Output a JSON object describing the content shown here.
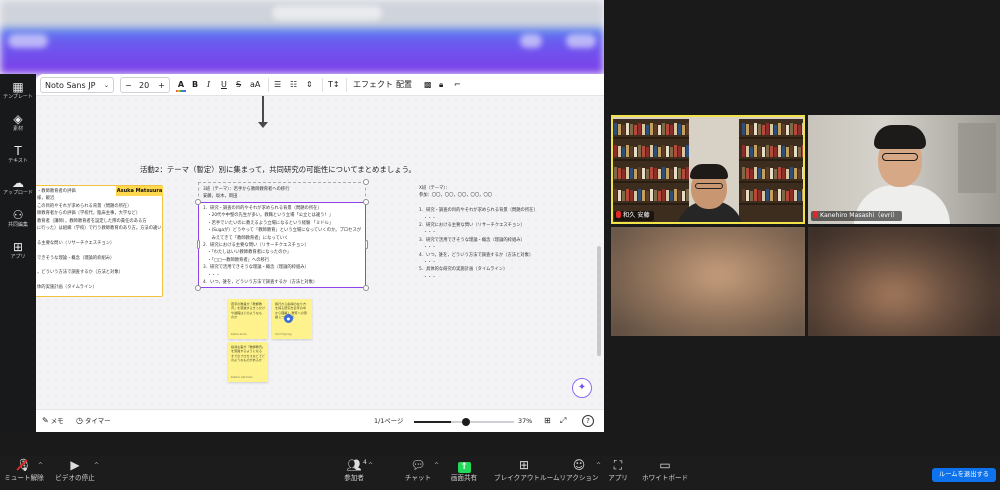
{
  "canva": {
    "font_name": "Noto Sans JP",
    "font_size": "20",
    "effect_label": "エフェクト",
    "arrange_label": "配置",
    "sidebar": [
      {
        "label": "テンプレート",
        "icon": "template-icon",
        "glyph": "▦"
      },
      {
        "label": "素材",
        "icon": "elements-icon",
        "glyph": "◈"
      },
      {
        "label": "テキスト",
        "icon": "text-icon",
        "glyph": "T"
      },
      {
        "label": "アップロード",
        "icon": "upload-icon",
        "glyph": "☁"
      },
      {
        "label": "共同編集",
        "icon": "share-icon",
        "glyph": "⚇"
      },
      {
        "label": "アプリ",
        "icon": "apps-icon",
        "glyph": "⊞"
      }
    ],
    "heading": "活動2：テーマ（暫定）別に集まって，共同研究の可能性についてまとめましょう。",
    "author_tag": "Asuka Matsuura",
    "card_left": {
      "line1": "・教師教育者の評価",
      "line2": "様，飯沼",
      "lines": [
        "この目的やそれが求められる背景（問題の所在）",
        "師教育者からの評価（学校代，臨床主事，大学など）",
        "教育者（講師），教師教育者を設定した際の責任のある方",
        "に行った）は組織（学校）で行う教師教育のあり方。方法の違い",
        "",
        "る主要な問い（リサーチクエスチョン）",
        "",
        "できそうな理論・概念（理論的枠組み）",
        "",
        "，どういう方法で調査するか（方法と対象）",
        "",
        "体的実施計画（タイムライン）"
      ]
    },
    "card_mid": {
      "title": "3班（テーマ）：若手から教師教育者への移行",
      "subtitle": "安藤，坂木，岡田",
      "lines": [
        "1．研究・調査の目的やそれが求められる背景（問題の所在）",
        "　・20代や中堅の先生が多い。教職という立場「公立とは違う！」",
        "　・若手でいたいのに教えるよう立場になるという経験 「ミドル」",
        "　・(Sugaが）どうやって「教師教育」という立場になっていくのか。プロセスが",
        "　　みえてきて「教師教育者」になっていく",
        "2．研究における主要な問い（リサーチクエスチョン）",
        "　・「わたしはいい教師教育者になったのか」",
        "　・「□□一教師教育者」への移行",
        "3．研究で活用できそうな理論・概念（理論的枠組み）",
        "　・・・",
        "4．いつ，誰を，どういう方法で調査するか（方法と対象）",
        "　・・・",
        "5．具体的な研究の実施計画（タイムライン）",
        "　・・・"
      ]
    },
    "card_right": {
      "title": "X班（テーマ）：",
      "subtitle": "参加：〇〇，〇〇，〇〇，〇〇，〇〇",
      "lines": [
        "1．研究・調査の目的やそれが求められる背景（問題の所在）",
        "　・・・",
        "2．研究における主要な問い（リサーチクエスチョン）",
        "　・・・",
        "3．研究で活用できそうな理論・概念（理論的枠組み）",
        "　・・・",
        "4．いつ，誰を，どういう方法で調査するか（方法と対象）",
        "　・・・",
        "5．具体的な研究の実施計画（タイムライン）",
        "　・・・"
      ]
    },
    "sticky_notes": [
      {
        "text": "若手の教員が「教師教育」を意識するきっかけや過程はどのようなものか",
        "author": "Kohei Ando",
        "color": "#fdf28b"
      },
      {
        "text": "移行から指導の在り方を探る研究を近年の中から理解し 教育への意識 についての",
        "author": "Yuki Fujinag",
        "color": "#fdf28b"
      },
      {
        "text": "指導主事が「教師教育」を意識するようになるまでのプロセスなどでどのようなものがあるか",
        "author": "Kotaro Akimoto",
        "color": "#fdf28b"
      }
    ],
    "notes_label": "メモ",
    "timer_label": "タイマー",
    "page_label": "1/1ページ",
    "zoom_label": "37%",
    "zoom_fraction": 0.37
  },
  "participants": [
    {
      "name": "和久 安藤",
      "blurred": false,
      "active_speaker": true,
      "muted": true,
      "kind": "study",
      "bg": "#3a2f24"
    },
    {
      "name": "Kanehiro Masashi（evri）",
      "blurred": false,
      "active_speaker": false,
      "muted": true,
      "kind": "room",
      "bg": "#b9b6ae"
    },
    {
      "name": "",
      "blurred": true,
      "active_speaker": false,
      "muted": false,
      "kind": "blur-warm",
      "bg": "#8a7664"
    },
    {
      "name": "",
      "blurred": true,
      "active_speaker": false,
      "muted": false,
      "kind": "blur-dark",
      "bg": "#5b4a3e"
    }
  ],
  "zoom_bar": {
    "items": [
      {
        "label": "ミュート解除",
        "icon": "mic-muted-icon",
        "caret": true
      },
      {
        "label": "ビデオの停止",
        "icon": "video-icon",
        "caret": true
      },
      {
        "label": "参加者",
        "icon": "participants-icon",
        "count": "4",
        "caret": true
      },
      {
        "label": "チャット",
        "icon": "chat-icon",
        "caret": true
      },
      {
        "label": "画面共有",
        "icon": "share-screen-icon",
        "caret": false
      },
      {
        "label": "ブレイクアウトルーム",
        "icon": "breakout-rooms-icon",
        "caret": false
      },
      {
        "label": "リアクション",
        "icon": "reactions-icon",
        "caret": true
      },
      {
        "label": "アプリ",
        "icon": "apps-icon",
        "caret": false
      },
      {
        "label": "ホワイトボード",
        "icon": "whiteboard-icon",
        "caret": false
      }
    ],
    "leave_label": "ルームを退出する"
  },
  "colors": {
    "share_green": "#23d959",
    "leave_blue": "#0e72ed",
    "speaker_yellow": "#f1e24a",
    "muted_red": "#e02828",
    "canva_purple": "#7d2ae8"
  }
}
